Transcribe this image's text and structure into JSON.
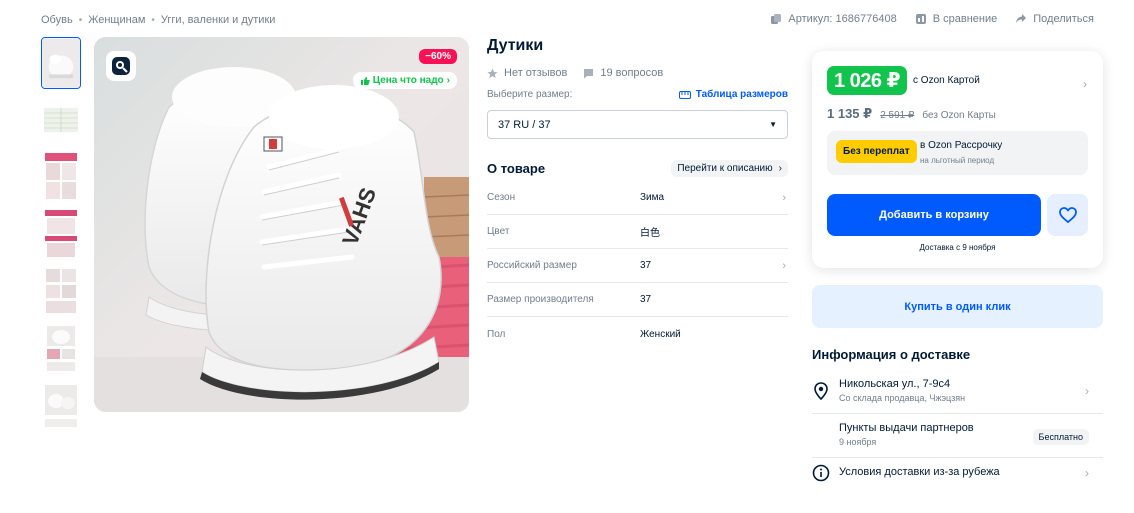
{
  "breadcrumbs": [
    "Обувь",
    "Женщинам",
    "Угги, валенки и дутики"
  ],
  "top_meta": {
    "article": "Артикул: 1686776408",
    "compare": "В сравнение",
    "share": "Поделиться"
  },
  "image": {
    "discount": "−60%",
    "good_price": "Цена что надо"
  },
  "product": {
    "title": "Дутики",
    "reviews": "Нет отзывов",
    "questions": "19 вопросов",
    "size_label": "Выберите размер:",
    "size_table": "Таблица размеров",
    "size_value": "37 RU / 37"
  },
  "about": {
    "title": "О товаре",
    "go_description": "Перейти к описанию",
    "props": [
      {
        "key": "Сезон",
        "value": "Зима"
      },
      {
        "key": "Цвет",
        "value": "白色"
      },
      {
        "key": "Российский размер",
        "value": "37"
      },
      {
        "key": "Размер производителя",
        "value": "37"
      },
      {
        "key": "Пол",
        "value": "Женский"
      }
    ]
  },
  "buy": {
    "card_price": "1 026 ₽",
    "card_price_label": "c Ozon Картой",
    "price": "1 135 ₽",
    "old_price": "2 591 ₽",
    "price_label": "без Ozon Карты",
    "installment_badge": "Без переплат",
    "installment_title": "в Ozon Рассрочку",
    "installment_sub": "на льготный период",
    "add_to_cart": "Добавить в корзину",
    "delivery_date": "Доставка с 9 ноября",
    "one_click": "Купить в один клик"
  },
  "delivery_info": {
    "title": "Информация о доставке",
    "rows": [
      {
        "line1": "Никольская ул., 7-9с4",
        "line2": "Со склада продавца, Чжэцзян"
      },
      {
        "line1": "Пункты выдачи партнеров",
        "line2": "9 ноября",
        "badge": "Бесплатно"
      },
      {
        "line1": "Условия доставки из-за рубежа"
      }
    ]
  },
  "colors": {
    "brand_blue": "#005bff",
    "green_price": "#10c44c",
    "discount_red": "#f91155",
    "installment_yellow": "#ffcc00"
  }
}
